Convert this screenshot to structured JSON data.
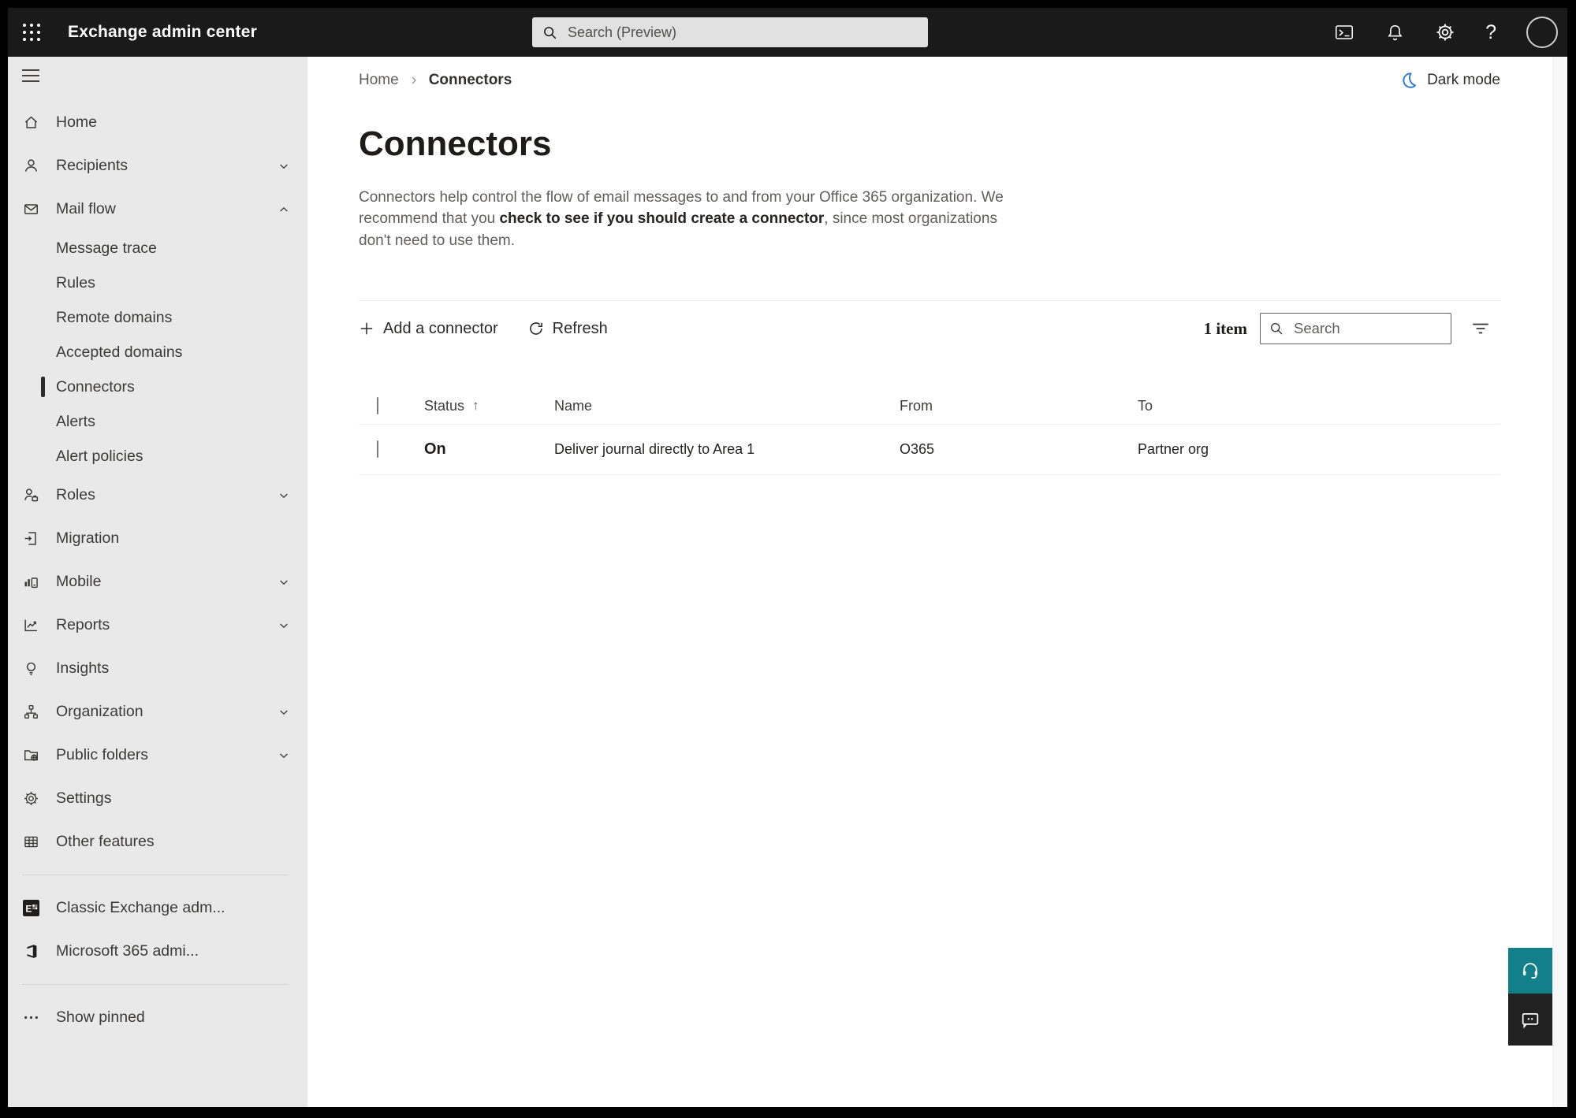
{
  "colors": {
    "topbar": "#1a1a1a",
    "sidebar_bg": "#e9e9e9",
    "accent_blue": "#2b7cd3",
    "support_teal": "#12808b",
    "selected_indicator": "#2b2b2b"
  },
  "header": {
    "app_title": "Exchange admin center",
    "search_placeholder": "Search (Preview)",
    "help_glyph": "?"
  },
  "sidebar": {
    "items": [
      {
        "label": "Home"
      },
      {
        "label": "Recipients"
      },
      {
        "label": "Mail flow"
      },
      {
        "label": "Roles"
      },
      {
        "label": "Migration"
      },
      {
        "label": "Mobile"
      },
      {
        "label": "Reports"
      },
      {
        "label": "Insights"
      },
      {
        "label": "Organization"
      },
      {
        "label": "Public folders"
      },
      {
        "label": "Settings"
      },
      {
        "label": "Other features"
      }
    ],
    "mailflow": [
      "Message trace",
      "Rules",
      "Remote domains",
      "Accepted domains",
      "Connectors",
      "Alerts",
      "Alert policies"
    ],
    "footer": [
      "Classic Exchange adm...",
      "Microsoft 365 admi..."
    ],
    "show_pinned": "Show pinned"
  },
  "main": {
    "breadcrumb": {
      "home": "Home",
      "current": "Connectors"
    },
    "dark_mode": "Dark mode",
    "title": "Connectors",
    "description": {
      "pre": "Connectors help control the flow of email messages to and from your Office 365 organization. We recommend that you ",
      "link": "check to see if you should create a connector",
      "post": ", since most organizations don't need to use them."
    },
    "toolbar": {
      "add": "Add a connector",
      "refresh": "Refresh",
      "count": "1 item",
      "search_placeholder": "Search"
    },
    "table": {
      "columns": [
        "Status",
        "Name",
        "From",
        "To"
      ],
      "sort_arrow": "↑",
      "rows": [
        {
          "status": "On",
          "name": "Deliver journal directly to Area 1",
          "from": "O365",
          "to": "Partner org"
        }
      ]
    }
  }
}
